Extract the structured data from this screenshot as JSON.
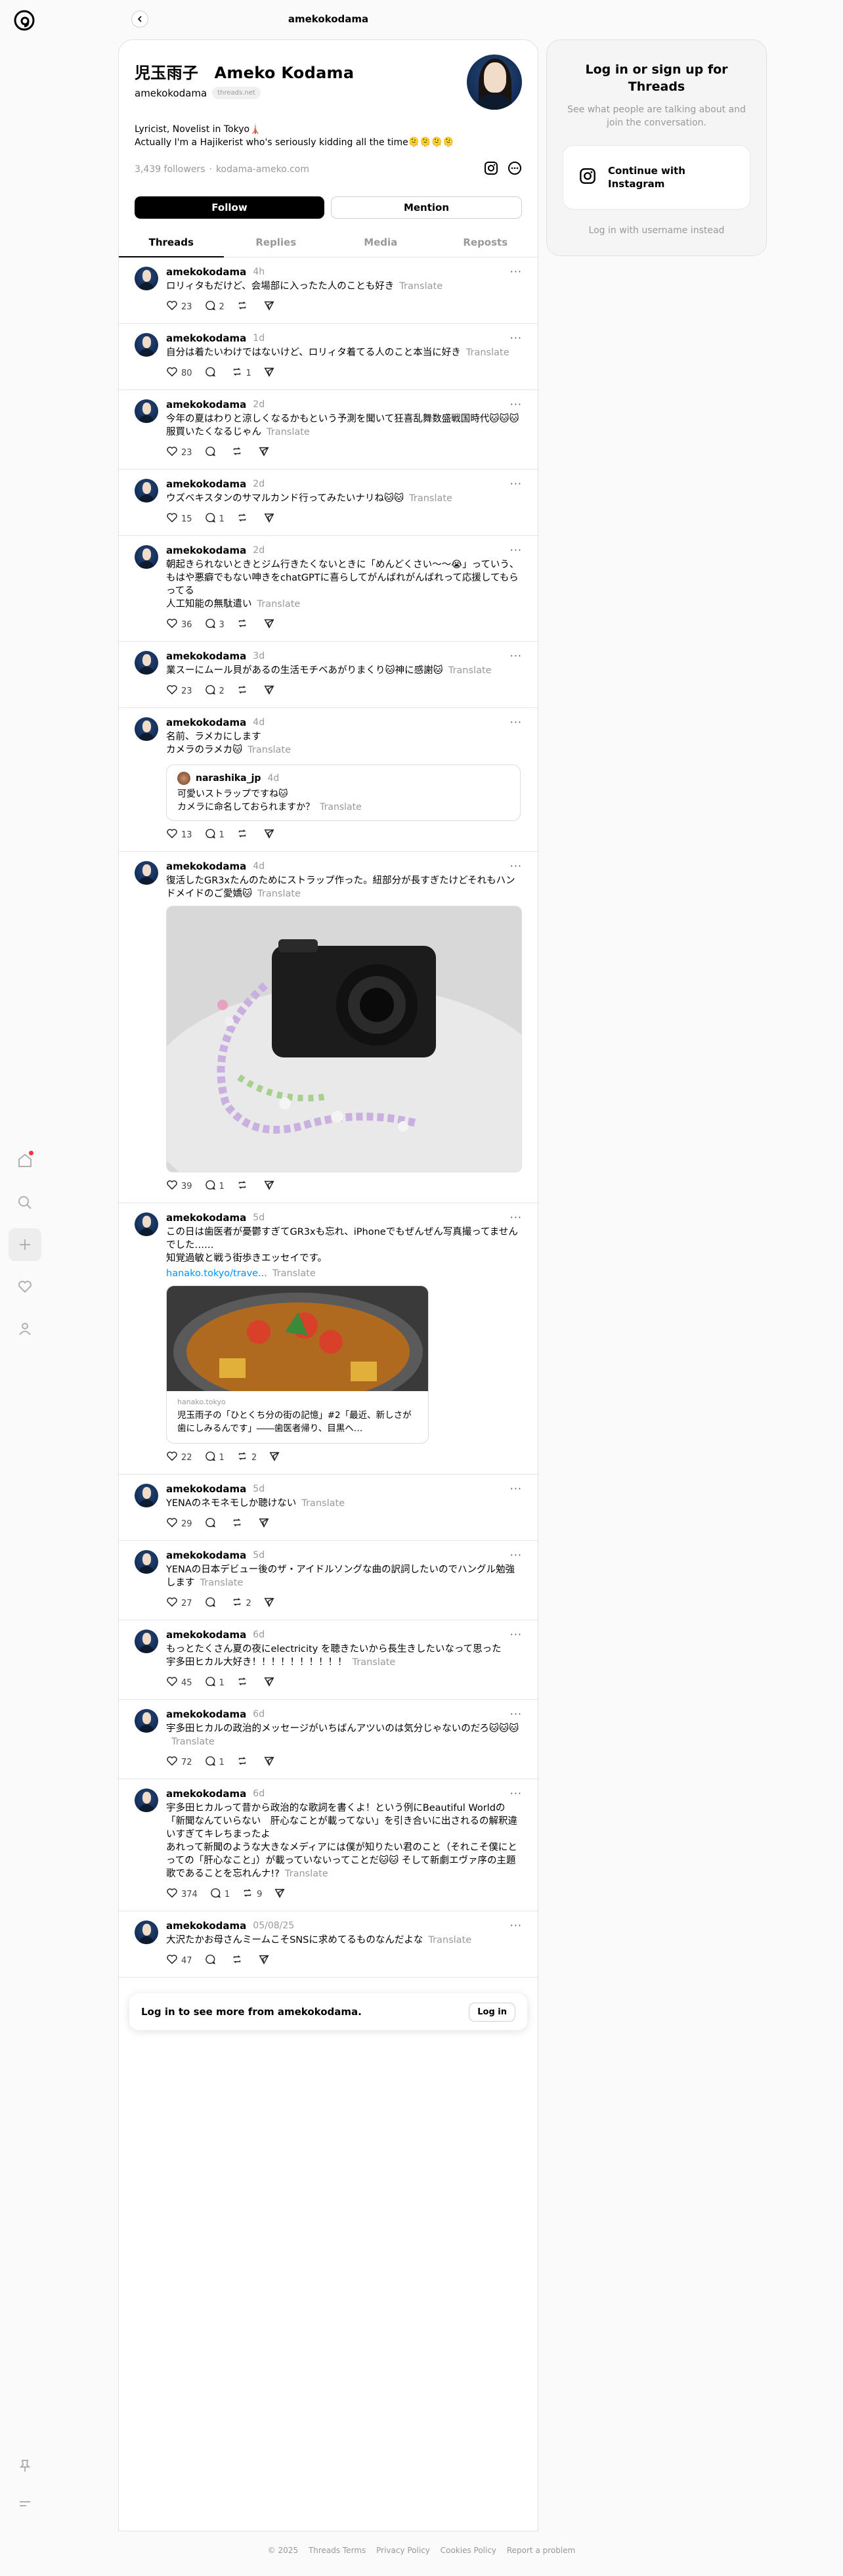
{
  "header": {
    "title": "amekokodama"
  },
  "profile": {
    "name": "児玉雨子　Ameko Kodama",
    "handle": "amekokodama",
    "domain": "threads.net",
    "bio_line1": "Lyricist, Novelist in Tokyo🗼",
    "bio_line2": "Actually I'm a Hajikerist who's seriously kidding all the time🫠🫠🫠🫠",
    "followers": "3,439 followers",
    "link": "kodama-ameko.com",
    "follow_label": "Follow",
    "mention_label": "Mention"
  },
  "tabs": [
    "Threads",
    "Replies",
    "Media",
    "Reposts"
  ],
  "translate": "Translate",
  "posts": [
    {
      "user": "amekokodama",
      "time": "4h",
      "text": "ロリィタもだけど、会場部に入ったた人のことも好き",
      "likes": "23",
      "replies": "2",
      "reposts": ""
    },
    {
      "user": "amekokodama",
      "time": "1d",
      "text": "自分は着たいわけではないけど、ロリィタ着てる人のこと本当に好き",
      "likes": "80",
      "replies": "",
      "reposts": "1"
    },
    {
      "user": "amekokodama",
      "time": "2d",
      "text": "今年の夏はわりと涼しくなるかもという予測を聞いて狂喜乱舞数盛戦国時代🐱🐱🐱\n服買いたくなるじゃん",
      "likes": "23",
      "replies": "",
      "reposts": ""
    },
    {
      "user": "amekokodama",
      "time": "2d",
      "text": "ウズベキスタンのサマルカンド行ってみたいナリね🐱🐱",
      "likes": "15",
      "replies": "1",
      "reposts": ""
    },
    {
      "user": "amekokodama",
      "time": "2d",
      "text": "朝起きられないときとジム行きたくないときに「めんどくさい〜〜😭」っていう、もはや悪癖でもない呻きをchatGPTに喜らしてがんばれがんばれって応援してもらってる\n人工知能の無駄遣い",
      "likes": "36",
      "replies": "3",
      "reposts": ""
    },
    {
      "user": "amekokodama",
      "time": "3d",
      "text": "業スーにムール貝があるの生活モチベあがりまくり🐱神に感謝🐱",
      "likes": "23",
      "replies": "2",
      "reposts": ""
    },
    {
      "user": "amekokodama",
      "time": "4d",
      "text": "名前、ラメカにします\nカメラのラメカ🐱",
      "likes": "13",
      "replies": "1",
      "reposts": "",
      "quote": {
        "user": "narashika_jp",
        "time": "4d",
        "text": "可愛いストラップですね🐱\nカメラに命名しておられますか？"
      }
    },
    {
      "user": "amekokodama",
      "time": "4d",
      "text": "復活したGR3xたんのためにストラップ作った。紐部分が長すぎたけどそれもハンドメイドのご愛嬌🐱",
      "likes": "39",
      "replies": "1",
      "reposts": ""
    },
    {
      "user": "amekokodama",
      "time": "5d",
      "text": "この日は歯医者が憂鬱すぎてGR3xも忘れ、iPhoneでもぜんぜん写真撮ってませんでした……\n知覚過敏と戦う街歩きエッセイです。",
      "link": "hanako.tokyo/trave...",
      "likes": "22",
      "replies": "1",
      "reposts": "2",
      "card": {
        "site": "hanako.tokyo",
        "title": "児玉雨子の「ひとくち分の街の記憶」#2「最近、新しさが歯にしみるんです」――歯医者帰り、目黒へ…"
      }
    },
    {
      "user": "amekokodama",
      "time": "5d",
      "text": "YENAのネモネモしか聴けない",
      "likes": "29",
      "replies": "",
      "reposts": ""
    },
    {
      "user": "amekokodama",
      "time": "5d",
      "text": "YENAの日本デビュー後のザ・アイドルソングな曲の訳詞したいのでハングル勉強します",
      "likes": "27",
      "replies": "",
      "reposts": "2"
    },
    {
      "user": "amekokodama",
      "time": "6d",
      "text": "もっとたくさん夏の夜にelectricity を聴きたいから長生きしたいなって思った\n宇多田ヒカル大好き！！！！！！！！！！",
      "likes": "45",
      "replies": "1",
      "reposts": ""
    },
    {
      "user": "amekokodama",
      "time": "6d",
      "text": "宇多田ヒカルの政治的メッセージがいちばんアツいのは気分じゃないのだろ🐱🐱🐱",
      "likes": "72",
      "replies": "1",
      "reposts": ""
    },
    {
      "user": "amekokodama",
      "time": "6d",
      "text": "宇多田ヒカルって昔から政治的な歌詞を書くよ！という例にBeautiful Worldの「新聞なんていらない　肝心なことが載ってない」を引き合いに出されるの解釈違いすぎてキレちまったよ\nあれって新聞のような大きなメディアには僕が知りたい君のこと（それこそ僕にとっての「肝心なこと」）が載っていないってことだ🐱🐱 そして新劇エヴァ序の主題歌であることを忘れんナ!?",
      "likes": "374",
      "replies": "1",
      "reposts": "9"
    },
    {
      "user": "amekokodama",
      "time": "05/08/25",
      "text": "大沢たかお母さんミームこそSNSに求めてるものなんだよな",
      "likes": "47",
      "replies": "",
      "reposts": ""
    }
  ],
  "login_banner": {
    "text": "Log in to see more from amekokodama.",
    "button": "Log in"
  },
  "sidebar": {
    "title": "Log in or sign up for Threads",
    "subtitle": "See what people are talking about and join the conversation.",
    "instagram_button": "Continue with Instagram",
    "alt_login": "Log in with username instead"
  },
  "footer": [
    "© 2025",
    "Threads Terms",
    "Privacy Policy",
    "Cookies Policy",
    "Report a problem"
  ]
}
